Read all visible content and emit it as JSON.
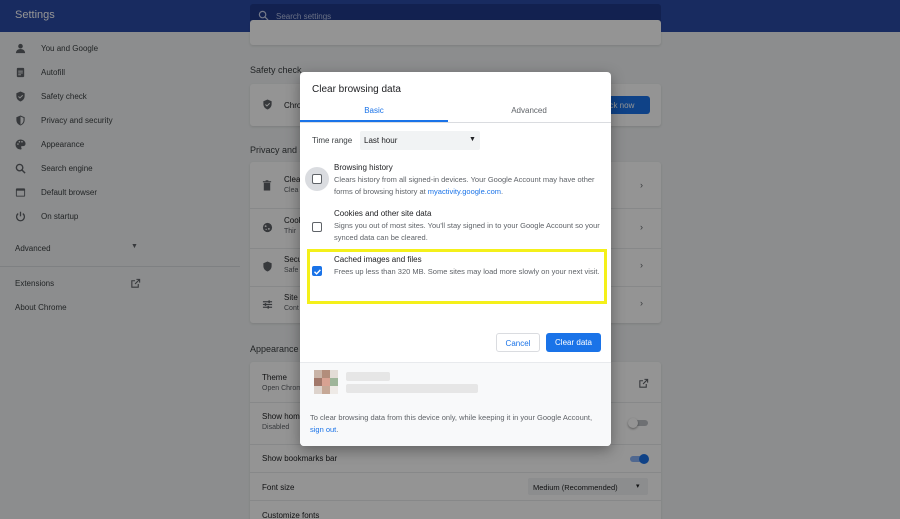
{
  "app_title": "Settings",
  "search": {
    "placeholder": "Search settings"
  },
  "sidebar": {
    "items": [
      {
        "label": "You and Google",
        "icon": "person-icon"
      },
      {
        "label": "Autofill",
        "icon": "clipboard-icon"
      },
      {
        "label": "Safety check",
        "icon": "shield-check-icon"
      },
      {
        "label": "Privacy and security",
        "icon": "shield-icon"
      },
      {
        "label": "Appearance",
        "icon": "palette-icon"
      },
      {
        "label": "Search engine",
        "icon": "search-icon"
      },
      {
        "label": "Default browser",
        "icon": "browser-icon"
      },
      {
        "label": "On startup",
        "icon": "power-icon"
      }
    ],
    "advanced": "Advanced",
    "extensions": "Extensions",
    "about": "About Chrome"
  },
  "background": {
    "safety_check": {
      "title": "Safety check",
      "row_title": "Chro",
      "button": "eck now"
    },
    "privacy": {
      "title": "Privacy and s",
      "rows": [
        {
          "title": "Clea",
          "sub": "Clea"
        },
        {
          "title": "Cook",
          "sub": "Thir"
        },
        {
          "title": "Secu",
          "sub": "Safe"
        },
        {
          "title": "Site",
          "sub": "Cont"
        }
      ]
    },
    "appearance": {
      "title": "Appearance",
      "theme": {
        "title": "Theme",
        "sub": "Open Chrom"
      },
      "home": {
        "title": "Show home",
        "sub": "Disabled"
      },
      "bookmarks": "Show bookmarks bar",
      "font_size": {
        "title": "Font size",
        "value": "Medium (Recommended)"
      },
      "customize_fonts": "Customize fonts"
    }
  },
  "dialog": {
    "title": "Clear browsing data",
    "tabs": {
      "basic": "Basic",
      "advanced": "Advanced"
    },
    "time_range": {
      "label": "Time range",
      "value": "Last hour"
    },
    "options": [
      {
        "title": "Browsing history",
        "desc": "Clears history from all signed-in devices. Your Google Account may have other forms of browsing history at ",
        "link": "myactivity.google.com",
        "desc_end": ".",
        "checked": false
      },
      {
        "title": "Cookies and other site data",
        "desc": "Signs you out of most sites. You'll stay signed in to your Google Account so your synced data can be cleared.",
        "checked": false
      },
      {
        "title": "Cached images and files",
        "desc": "Frees up less than 320 MB. Some sites may load more slowly on your next visit.",
        "checked": true
      }
    ],
    "buttons": {
      "cancel": "Cancel",
      "clear": "Clear data"
    },
    "footer": {
      "text": "To clear browsing data from this device only, while keeping it in your Google Account, ",
      "link": "sign out",
      "end": "."
    }
  },
  "colors": {
    "accent": "#1a73e8",
    "topbar": "#2a4aa6",
    "highlight": "#f4f01a"
  }
}
